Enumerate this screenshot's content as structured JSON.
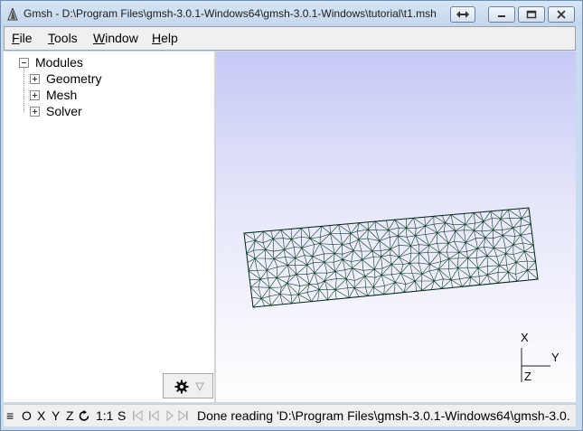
{
  "window": {
    "title": "Gmsh - D:\\Program Files\\gmsh-3.0.1-Windows64\\gmsh-3.0.1-Windows\\tutorial\\t1.msh",
    "icons": [
      "gmsh-app-icon",
      "resize-icon",
      "minimize-icon",
      "maximize-icon",
      "close-icon"
    ]
  },
  "menu": {
    "file": {
      "u": "F",
      "rest": "ile"
    },
    "tools": {
      "u": "T",
      "rest": "ools"
    },
    "window": {
      "u": "W",
      "rest": "indow"
    },
    "help": {
      "u": "H",
      "rest": "elp"
    }
  },
  "tree": {
    "root": "Modules",
    "items": [
      "Geometry",
      "Mesh",
      "Solver"
    ]
  },
  "gear_button": {
    "icon": "gear-icon",
    "dropdown_icon": "dropdown-arrow-icon"
  },
  "axes": {
    "x": "X",
    "y": "Y",
    "z": "Z"
  },
  "statusbar": {
    "menu_icon": "≡",
    "o": "O",
    "x": "X",
    "y": "Y",
    "z": "Z",
    "rotate_icon": "rotate-icon",
    "scale": "1:1",
    "s": "S",
    "nav_icons": [
      "first-icon",
      "prev-icon",
      "play-icon",
      "last-icon"
    ],
    "message": "Done reading 'D:\\Program Files\\gmsh-3.0.1-Windows64\\gmsh-3.0."
  }
}
